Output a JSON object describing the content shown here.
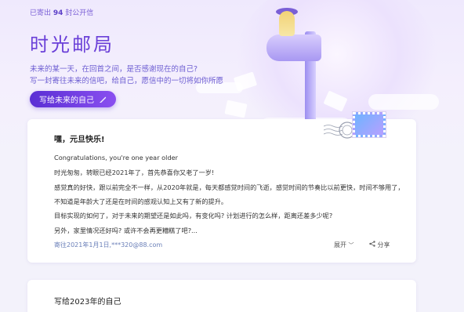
{
  "header": {
    "sent_prefix": "已寄出",
    "sent_count": "94",
    "sent_suffix": "封公开信",
    "title": "时光邮局",
    "subtitle_1": "未来的某一天，在回首之间，是否感谢现在的自己?",
    "subtitle_2": "写一封寄往未来的信吧，给自己，愿信中的一切将如你所愿",
    "write_button_label": "写给未来的自己"
  },
  "letter": {
    "greeting": "嘿，元旦快乐!",
    "lines": [
      "Congratulations, you're one year older",
      "时光匆匆，转眼已经2021年了，首先恭喜你又老了一岁!",
      "感觉真的好快，跟以前完全不一样，从2020年就是，每天都感觉时间的飞逝，感觉时间的节奏比以前更快，时间不够用了，",
      "不知道是年龄大了还是在时间的感观认知上又有了新的提升。",
      "目标实现的如何了，对于未来的期望还是如此吗，有变化吗? 计划进行的怎么样，距离还差多少呢?",
      "另外，家里情况还好吗? 或许不会再更糟糕了吧?..."
    ],
    "meta": "寄往2021年1月1日,***320@88.com",
    "expand_label": "展开",
    "share_label": "分享"
  },
  "letter2": {
    "title": "写给2023年的自己"
  },
  "colors": {
    "accent": "#6a3fd8",
    "button": "#5a2fd4",
    "meta": "#6a7fb8"
  }
}
